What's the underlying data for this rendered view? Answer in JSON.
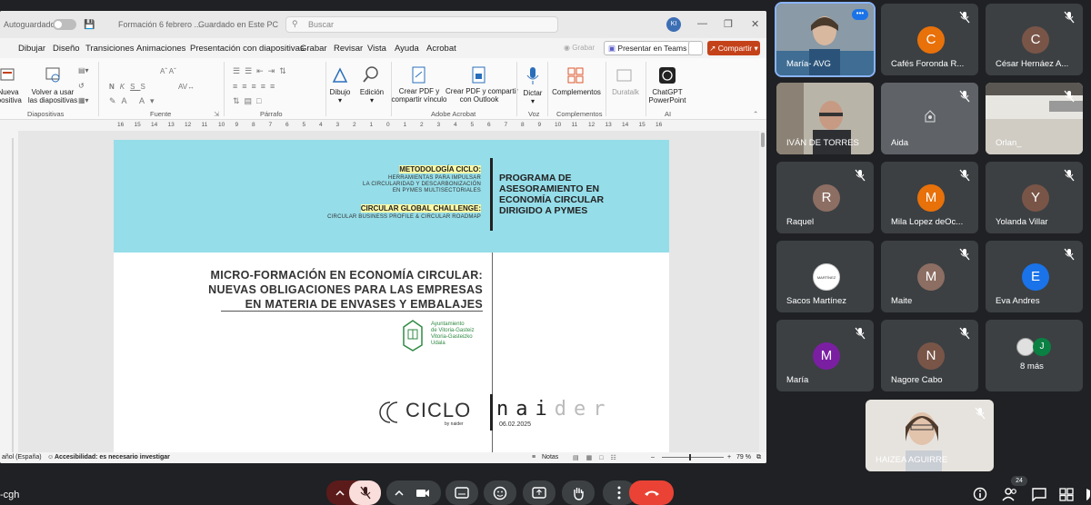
{
  "app": {
    "autosave_label": "Autoguardado",
    "file_title": "Formación 6 febrero ...",
    "save_location": "Guardado en Este PC",
    "search_placeholder": "Buscar",
    "user_initials": "KI"
  },
  "menu": {
    "items": [
      "Dibujar",
      "Diseño",
      "Transiciones",
      "Animaciones",
      "Presentación con diapositivas",
      "Grabar",
      "Revisar",
      "Vista",
      "Ayuda",
      "Acrobat"
    ],
    "grabar_btn": "Grabar",
    "present_teams": "Presentar en Teams",
    "share": "Compartir"
  },
  "ribbon": {
    "nueva": [
      "Nueva",
      "diapositiva"
    ],
    "reuse": [
      "Volver a usar",
      "las diapositivas"
    ],
    "dibujo": "Dibujo",
    "edicion": "Edición",
    "crear_pdf": [
      "Crear PDF y",
      "compartir vínculo"
    ],
    "crear_pdf_outlook": [
      "Crear PDF y compartir",
      "con Outlook"
    ],
    "dictar": "Dictar",
    "complementos": "Complementos",
    "duratalk": "Duratalk",
    "chatgpt": [
      "ChatGPT",
      "PowerPoint"
    ],
    "groups": [
      "Diapositivas",
      "Fuente",
      "Párrafo",
      "Adobe Acrobat",
      "Voz",
      "Complementos",
      "AI"
    ]
  },
  "ruler_ticks": [
    "16",
    "15",
    "14",
    "13",
    "12",
    "11",
    "10",
    "9",
    "8",
    "7",
    "6",
    "5",
    "4",
    "3",
    "2",
    "1",
    "0",
    "1",
    "2",
    "3",
    "4",
    "5",
    "6",
    "7",
    "8",
    "9",
    "10",
    "11",
    "12",
    "13",
    "14",
    "15",
    "16"
  ],
  "slide": {
    "metodologia_title": "METODOLOGÍA CICLO:",
    "metodologia_lines": [
      "HERRAMIENTAS PARA IMPULSAR",
      "LA CIRCULARIDAD Y DESCARBONIZACIÓN",
      "EN PYMES MULTISECTORIALES"
    ],
    "challenge_title": "CIRCULAR GLOBAL CHALLENGE:",
    "challenge_line": "CIRCULAR BUSINESS PROFILE & CIRCULAR ROADMAP",
    "programa": [
      "PROGRAMA DE",
      "ASESORAMIENTO EN",
      "ECONOMÍA CIRCULAR",
      "DIRIGIDO A PYMES"
    ],
    "micro": [
      "MICRO-FORMACIÓN EN ECONOMÍA CIRCULAR:",
      "NUEVAS OBLIGACIONES PARA LAS EMPRESAS",
      "EN MATERIA DE ENVASES Y EMBALAJES"
    ],
    "ayto": [
      "Ayuntamiento",
      "de Vitoria-Gasteiz",
      "Vitoria-Gasteizko",
      "Udala"
    ],
    "ciclo": "CICLO",
    "by_naider": "by naider",
    "naider_dark": "nai",
    "naider_light": "der",
    "date": "06.02.2025"
  },
  "status": {
    "language": "añol (España)",
    "accessibility": "Accesibilidad: es necesario investigar",
    "notes": "Notas",
    "zoom": "79 %"
  },
  "participants": [
    {
      "name": "María- AVG",
      "kind": "video",
      "active": true
    },
    {
      "name": "Cafés Foronda R...",
      "initial": "C",
      "color": "#e8710a"
    },
    {
      "name": "César Hernáez A...",
      "initial": "C",
      "color": "#795548"
    },
    {
      "name": "IVÁN DE TORRES",
      "kind": "video"
    },
    {
      "name": "Aida",
      "kind": "video"
    },
    {
      "name": "Orlan_",
      "kind": "video"
    },
    {
      "name": "Raquel",
      "initial": "R",
      "color": "#8d6e63"
    },
    {
      "name": "Mila Lopez deOc...",
      "initial": "M",
      "color": "#e8710a"
    },
    {
      "name": "Yolanda Villar",
      "initial": "Y",
      "color": "#795548"
    },
    {
      "name": "Sacos Martínez",
      "initial": "MARTÍNEZ",
      "color": "#ffffff"
    },
    {
      "name": "Maite",
      "initial": "M",
      "color": "#8d6e63"
    },
    {
      "name": "Eva Andres",
      "initial": "E",
      "color": "#1a73e8"
    },
    {
      "name": "María",
      "initial": "M",
      "color": "#7b1fa2"
    },
    {
      "name": "Nagore Cabo",
      "initial": "N",
      "color": "#795548"
    },
    {
      "name": "8 más",
      "initial": "J",
      "color": "#0b8043"
    },
    {
      "name": "HAIZEA AGUIRRE",
      "kind": "video"
    }
  ],
  "bottom": {
    "meeting_code": "-cgh",
    "people_count": "24"
  }
}
